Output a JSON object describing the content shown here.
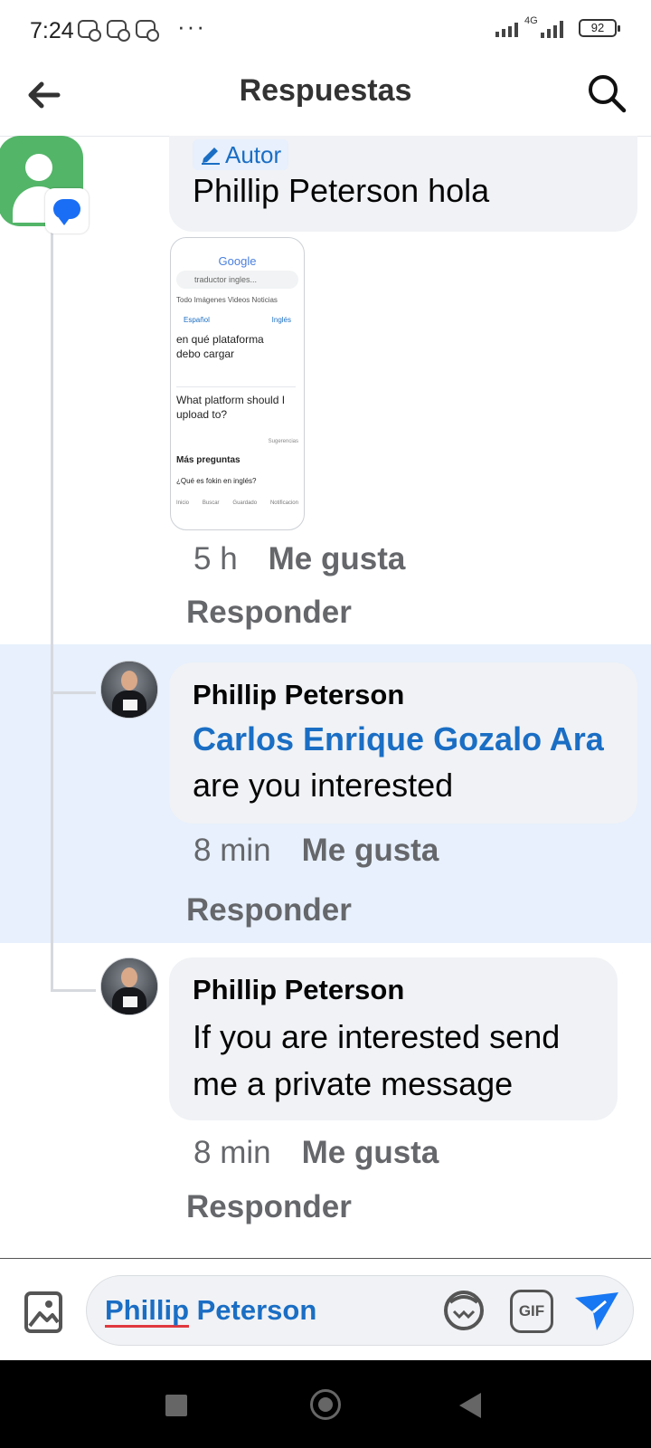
{
  "status_bar": {
    "time": "7:24",
    "more": "···",
    "network": "4G",
    "battery": "92"
  },
  "header": {
    "title": "Respuestas"
  },
  "comments": [
    {
      "author_tag": "Autor",
      "text": "Phillip Peterson hola",
      "attachment": {
        "logo": "Google",
        "search_query": "traductor ingles...",
        "tabs": "Todo  Imágenes  Videos  Noticias",
        "source_lang": "Español",
        "target_lang": "Inglés",
        "source_text": "en qué plataforma debo cargar",
        "translated_text": "What platform should I upload to?",
        "suggestions": "Sugerencias",
        "more_questions": "Más preguntas",
        "faq": "¿Qué es fokin en inglés?",
        "nav": [
          "Inicio",
          "Buscar",
          "Guardado",
          "Notificacion"
        ]
      },
      "time": "5 h",
      "like": "Me gusta",
      "reply": "Responder"
    },
    {
      "name": "Phillip Peterson",
      "mention": "Carlos Enrique Gozalo Ara",
      "text": "are you interested",
      "time": "8 min",
      "like": "Me gusta",
      "reply": "Responder"
    },
    {
      "name": "Phillip Peterson",
      "text_line1": "If you are interested send",
      "text_line2": "me a private message",
      "time": "8 min",
      "like": "Me gusta",
      "reply": "Responder"
    }
  ],
  "composer": {
    "mention_first": "Phillip",
    "mention_last": "Peterson",
    "gif_label": "GIF"
  },
  "colors": {
    "link_blue": "#1a6ec4",
    "highlight_bg": "#e7f0fc",
    "bubble_bg": "#f0f2f5",
    "send_blue": "#1877f2"
  }
}
